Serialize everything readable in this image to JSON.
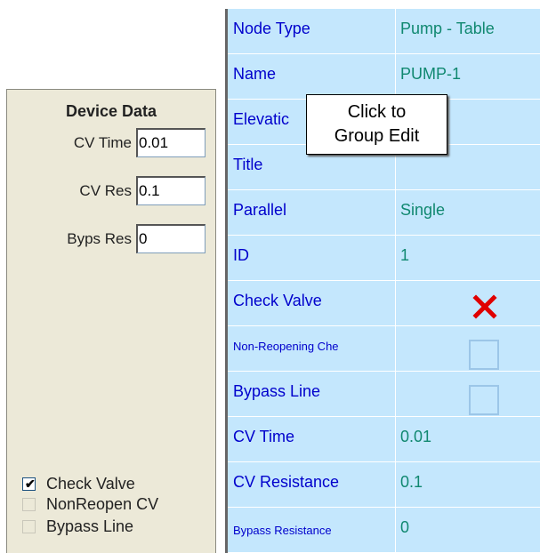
{
  "device_panel": {
    "title": "Device Data",
    "fields": [
      {
        "label": "CV Time",
        "value": "0.01"
      },
      {
        "label": "CV Res",
        "value": "0.1"
      },
      {
        "label": "Byps Res",
        "value": "0"
      }
    ],
    "checkboxes": [
      {
        "label": "Check Valve",
        "checked": true
      },
      {
        "label": "NonReopen CV",
        "checked": false
      },
      {
        "label": "Bypass Line",
        "checked": false
      }
    ]
  },
  "property_grid": {
    "rows": [
      {
        "name": "Node Type",
        "value": "Pump - Table"
      },
      {
        "name": "Name",
        "value": "PUMP-1"
      },
      {
        "name": "Elevatic",
        "value": ""
      },
      {
        "name": "Title",
        "value": ""
      },
      {
        "name": "Parallel",
        "value": "Single"
      },
      {
        "name": "ID",
        "value": "1"
      },
      {
        "name": "Check Valve",
        "value": "checked"
      },
      {
        "name": "Non-Reopening Che",
        "value": "unchecked"
      },
      {
        "name": "Bypass Line",
        "value": "unchecked"
      },
      {
        "name": "CV Time",
        "value": "0.01"
      },
      {
        "name": "CV Resistance",
        "value": "0.1"
      },
      {
        "name": "Bypass Resistance",
        "value": "0"
      }
    ]
  },
  "tooltip": {
    "line1": "Click to",
    "line2": "Group Edit"
  },
  "colors": {
    "grid_bg": "#c4e7fd",
    "name_text": "#0000cc",
    "value_text": "#108870",
    "panel_bg": "#ece9d8",
    "check_mark": "#e00000"
  }
}
